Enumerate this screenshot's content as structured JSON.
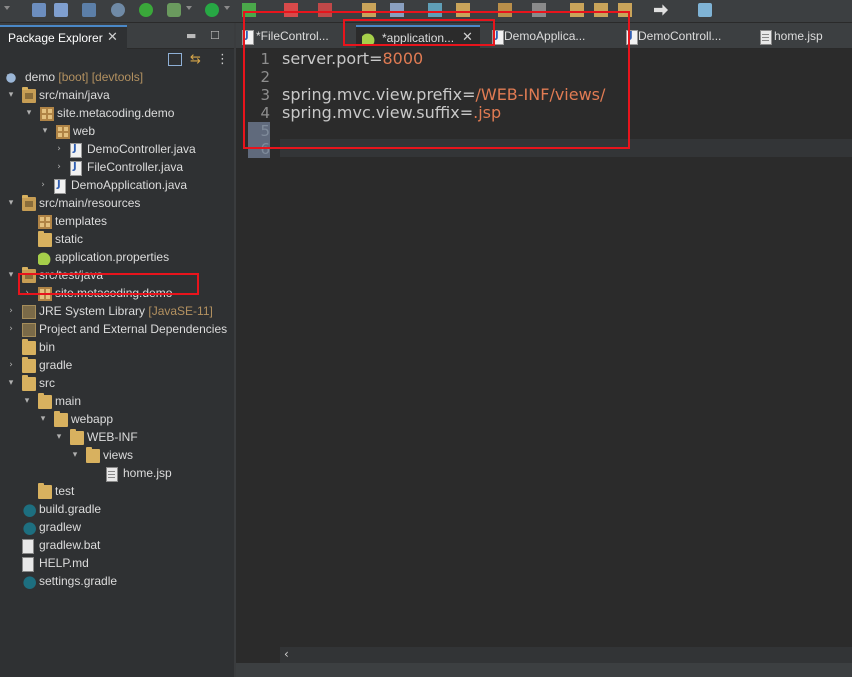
{
  "toolbar": {
    "icons": [
      "menu-dropdown-icon",
      "save-icon",
      "save-all-icon",
      "terminal-icon",
      "skip-breakpoints-icon",
      "spring-boot-icon",
      "debug-icon",
      "run-icon",
      "external-tools-icon",
      "stop-icon",
      "new-server-icon",
      "open-type-icon",
      "search-icon",
      "annotation-icon",
      "prev-annotation-icon",
      "back-icon",
      "forward-icon",
      "open-perspective-icon"
    ]
  },
  "explorer": {
    "tab_label": "Package Explorer",
    "close_glyph": "✕",
    "tree": [
      {
        "label": "demo",
        "deco": " [boot] [devtools]",
        "icon": "project-icon",
        "arrow": "▾"
      },
      {
        "label": "src/main/java",
        "icon": "source-folder-icon",
        "arrow": "▾"
      },
      {
        "label": "site.metacoding.demo",
        "icon": "package-icon",
        "arrow": "▾"
      },
      {
        "label": "web",
        "icon": "package-icon",
        "arrow": "▾"
      },
      {
        "label": "DemoController.java",
        "icon": "java-file-icon",
        "arrow": "›"
      },
      {
        "label": "FileController.java",
        "icon": "java-file-icon",
        "arrow": "›"
      },
      {
        "label": "DemoApplication.java",
        "icon": "java-file-icon",
        "arrow": "›"
      },
      {
        "label": "src/main/resources",
        "icon": "source-folder-icon",
        "arrow": "▾"
      },
      {
        "label": "templates",
        "icon": "package-icon",
        "arrow": ""
      },
      {
        "label": "static",
        "icon": "folder-icon",
        "arrow": ""
      },
      {
        "label": "application.properties",
        "icon": "spring-leaf-icon",
        "arrow": ""
      },
      {
        "label": "src/test/java",
        "icon": "source-folder-icon",
        "arrow": "▾"
      },
      {
        "label": "site.metacoding.demo",
        "icon": "package-icon",
        "arrow": "›"
      },
      {
        "label": "JRE System Library",
        "deco": " [JavaSE-11]",
        "icon": "library-icon",
        "arrow": "›"
      },
      {
        "label": "Project and External Dependencies",
        "icon": "library-icon",
        "arrow": "›"
      },
      {
        "label": "bin",
        "icon": "folder-icon",
        "arrow": ""
      },
      {
        "label": "gradle",
        "icon": "folder-icon",
        "arrow": "›"
      },
      {
        "label": "src",
        "icon": "folder-icon",
        "arrow": "▾"
      },
      {
        "label": "main",
        "icon": "folder-icon",
        "arrow": "▾"
      },
      {
        "label": "webapp",
        "icon": "folder-icon",
        "arrow": "▾"
      },
      {
        "label": "WEB-INF",
        "icon": "folder-icon",
        "arrow": "▾"
      },
      {
        "label": "views",
        "icon": "folder-icon",
        "arrow": "▾"
      },
      {
        "label": "home.jsp",
        "icon": "jsp-file-icon",
        "arrow": ""
      },
      {
        "label": "test",
        "icon": "folder-icon",
        "arrow": ""
      },
      {
        "label": "build.gradle",
        "icon": "gradle-icon",
        "arrow": ""
      },
      {
        "label": "gradlew",
        "icon": "gradle-icon",
        "arrow": ""
      },
      {
        "label": "gradlew.bat",
        "icon": "file-icon",
        "arrow": ""
      },
      {
        "label": "HELP.md",
        "icon": "markdown-file-icon",
        "arrow": ""
      },
      {
        "label": "settings.gradle",
        "icon": "gradle-icon",
        "arrow": ""
      }
    ]
  },
  "editor": {
    "tabs": [
      {
        "label": "*FileControl...",
        "icon": "java-file-icon",
        "active": false
      },
      {
        "label": "*application...",
        "icon": "spring-leaf-icon",
        "active": true,
        "close": "✕"
      },
      {
        "label": "DemoApplica...",
        "icon": "java-file-icon",
        "active": false
      },
      {
        "label": "DemoControll...",
        "icon": "java-file-icon",
        "active": false
      },
      {
        "label": "home.jsp",
        "icon": "jsp-file-icon",
        "active": false
      }
    ],
    "line_numbers": [
      "1",
      "2",
      "3",
      "4",
      "5",
      "6"
    ],
    "lines": [
      {
        "key": "server.port=",
        "value": "8000"
      },
      {
        "key": "",
        "value": ""
      },
      {
        "key": "spring.mvc.view.prefix=",
        "value": "/WEB-INF/views/"
      },
      {
        "key": "spring.mvc.view.suffix=",
        "value": ".jsp"
      },
      {
        "key": "",
        "value": ""
      },
      {
        "key": "",
        "value": ""
      }
    ],
    "scroll_left_glyph": "‹"
  },
  "colors": {
    "highlight": "#e8141c",
    "accent": "#4a88c7",
    "property_value": "#e07b53"
  }
}
